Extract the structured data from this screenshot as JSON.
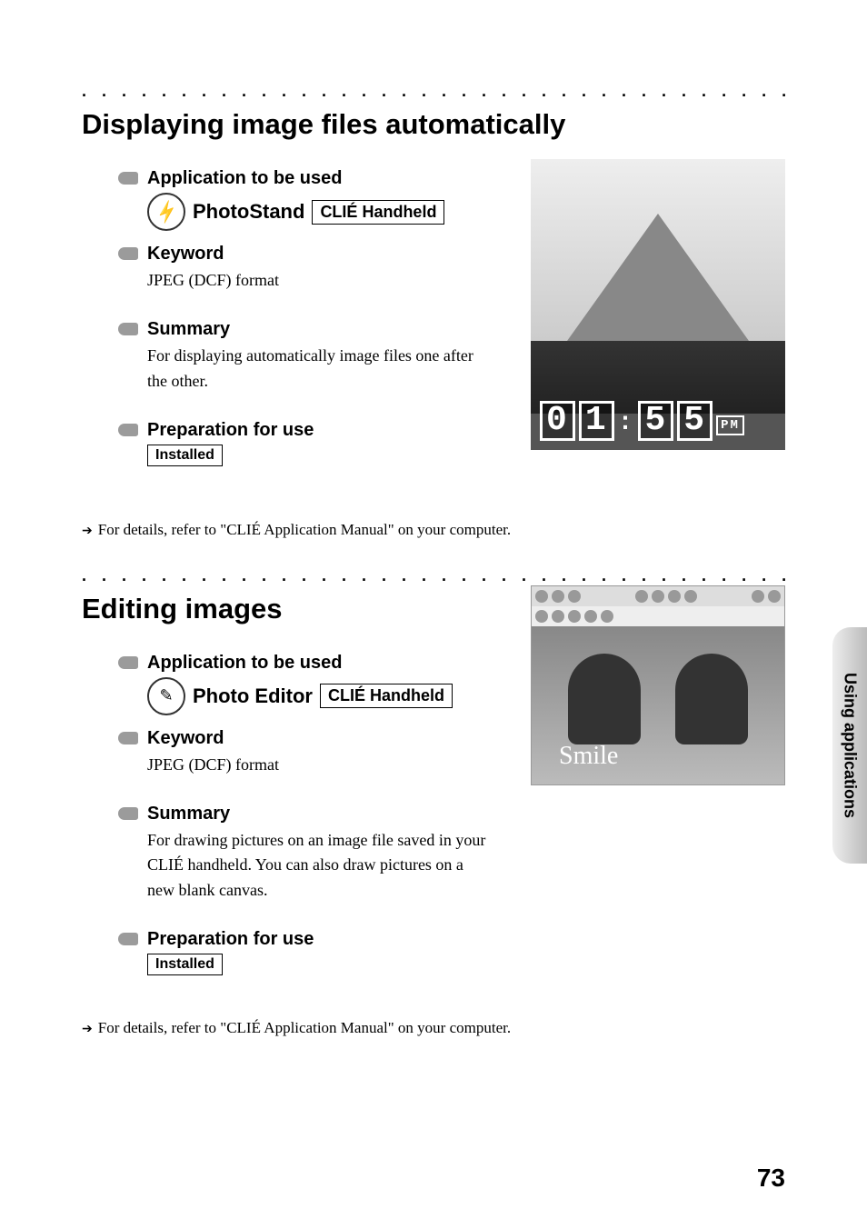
{
  "side_tab": "Using applications",
  "page_number": "73",
  "sections": [
    {
      "dots": ". . . . . . . . . . . . . . . . . . . . . . . . . . . . . . . . . . . . . . . . . . . . . . . . . . . . . . . . .",
      "title": "Displaying image files automatically",
      "application_heading": "Application to be used",
      "app_name": "PhotoStand",
      "app_platform": "CLIÉ Handheld",
      "keyword_heading": "Keyword",
      "keyword_text": "JPEG (DCF) format",
      "summary_heading": "Summary",
      "summary_text": "For displaying automatically image files one after the other.",
      "prep_heading": "Preparation for use",
      "prep_tag": "Installed",
      "details": "For details, refer to \"CLIÉ Application Manual\" on your computer.",
      "screenshot": {
        "clock": {
          "d1": "0",
          "d2": "1",
          "sep": ":",
          "d3": "5",
          "d4": "5",
          "ampm": "PM"
        }
      }
    },
    {
      "dots": ". . . . . . . . . . . . . . . . . . . . . . . . . . . . . . . . . . . . . . . . . . . . . . . . . . . . . . . . .",
      "title": "Editing images",
      "application_heading": "Application to be used",
      "app_name": "Photo Editor",
      "app_platform": "CLIÉ Handheld",
      "keyword_heading": "Keyword",
      "keyword_text": "JPEG (DCF) format",
      "summary_heading": "Summary",
      "summary_text": "For drawing pictures on an image file saved in your CLIÉ handheld. You can also draw pictures on a new blank canvas.",
      "prep_heading": "Preparation for use",
      "prep_tag": "Installed",
      "details": "For details, refer to \"CLIÉ Application Manual\" on your computer."
    }
  ]
}
